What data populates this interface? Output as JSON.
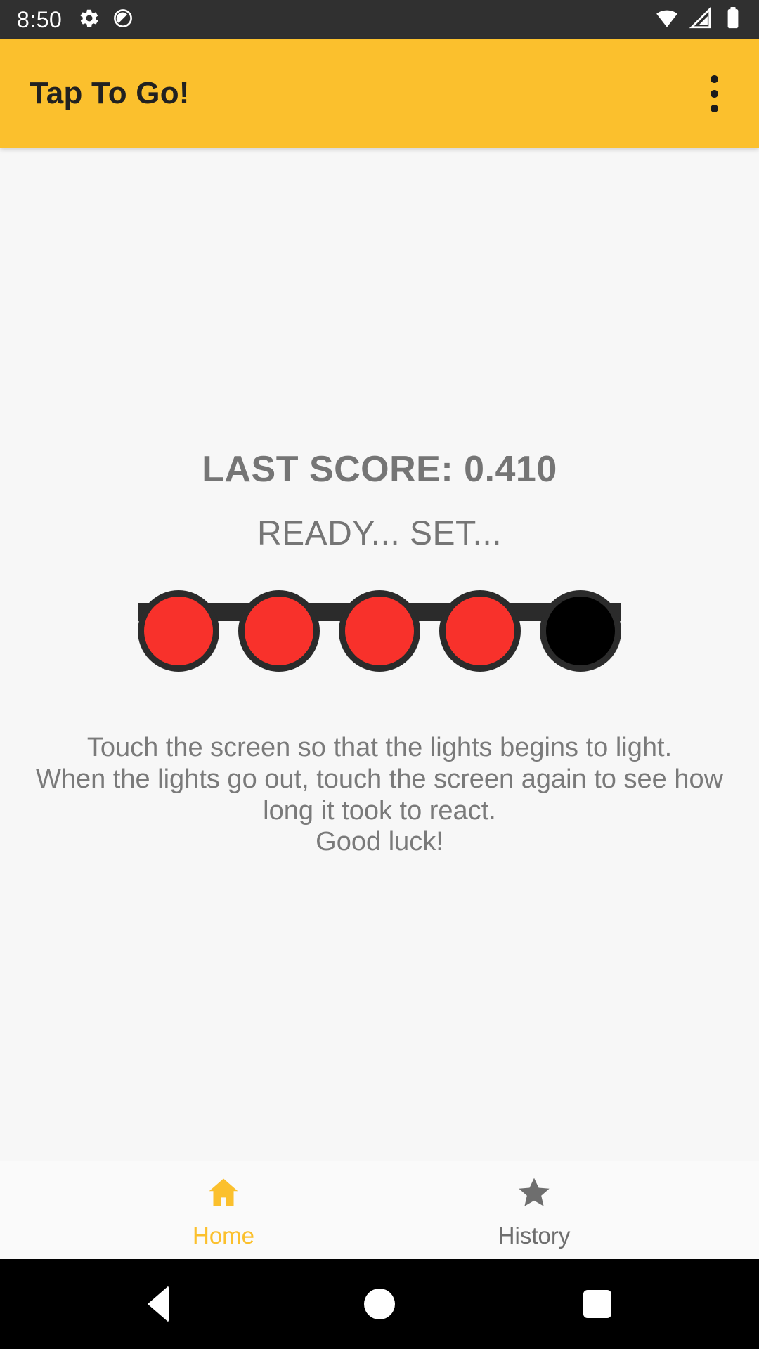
{
  "status_bar": {
    "time": "8:50",
    "left_icons": [
      "gear-icon",
      "circle-slash-icon"
    ],
    "right_icons": [
      "wifi-icon",
      "cell-signal-icon",
      "battery-icon"
    ],
    "background_color": "#303030"
  },
  "app_bar": {
    "title": "Tap To Go!",
    "overflow_menu": "more-options",
    "background_color": "#FBC02D",
    "title_color": "#212121"
  },
  "main": {
    "last_score_label": "LAST SCORE: 0.410",
    "state_label": "READY... SET...",
    "lights": {
      "count": 5,
      "states": [
        "on",
        "on",
        "on",
        "on",
        "off"
      ],
      "on_color": "#F8312B",
      "off_color": "#000000",
      "bar_color": "#2B2B2B"
    },
    "instructions": [
      "Touch the screen so that the lights begins to light.",
      "When the lights go out, touch the screen again to see how",
      "long it took to react.",
      "Good luck!"
    ],
    "text_color": "#757575",
    "background_color": "#F7F7F7"
  },
  "bottom_nav": {
    "items": [
      {
        "label": "Home",
        "icon": "home-icon",
        "active": true,
        "color": "#FBC02D"
      },
      {
        "label": "History",
        "icon": "star-icon",
        "active": false,
        "color": "#6E6E6E"
      }
    ]
  },
  "system_nav": {
    "back": "back-triangle",
    "home": "home-circle",
    "recents": "recents-square",
    "background_color": "#000000"
  }
}
